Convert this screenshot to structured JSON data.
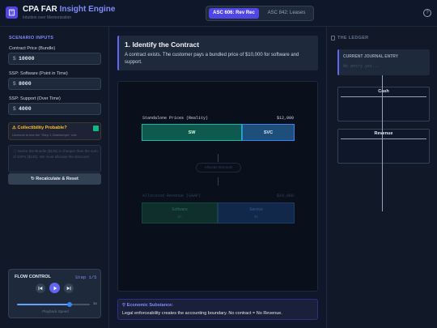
{
  "header": {
    "title_main": "CPA FAR",
    "title_accent": "Insight Engine",
    "subtitle": "Intuition over Memorization",
    "tabs": [
      {
        "label": "ASC 606: Rev Rec",
        "active": true
      },
      {
        "label": "ASC 842: Leases",
        "active": false
      }
    ],
    "help_icon": "?"
  },
  "sidebar": {
    "section_title": "SCENARIO INPUTS",
    "fields": [
      {
        "label": "Contract Price (Bundle)",
        "currency": "$",
        "value": "10000"
      },
      {
        "label": "SSP: Software (Point in Time)",
        "currency": "$",
        "value": "8000"
      },
      {
        "label": "SSP: Support (Over Time)",
        "currency": "$",
        "value": "4000"
      }
    ],
    "collectibility": {
      "label": "Collectibility Probable?",
      "sublabel": "Uncheck to test the \"Step 1 Gatekeeper\" rule.",
      "checked": true
    },
    "notice": "Notice the Bundle ($10k) is cheaper than the sum of SSPs ($12k). We must allocate the discount!",
    "reset_label": "Recalculate & Reset",
    "flow_control": {
      "title": "FLOW CONTROL",
      "step": "Step 1/5",
      "speed_value": "1x",
      "speed_label": "Playback Speed",
      "speed_level": 0.72
    }
  },
  "main": {
    "step_title": "1. Identify the Contract",
    "step_desc": "A contract exists. The customer pays a bundled price of $10,000 for software and support.",
    "viz": {
      "standalone_label": "Standalone Prices (Reality)",
      "standalone_total": "$12,000",
      "sw_label": "SW",
      "svc_label": "SVC",
      "allocate_label": "Allocate Discount",
      "allocated_label": "Allocated Revenue (GAAP)",
      "allocated_total": "$10,000",
      "alloc_sw_label": "Software",
      "alloc_sw_value": "$0",
      "alloc_svc_label": "Service",
      "alloc_svc_value": "$0"
    },
    "econ": {
      "title": "Economic Substance:",
      "desc": "Legal enforceability creates the accounting boundary. No contract = No Revenue."
    }
  },
  "ledger": {
    "title": "THE LEDGER",
    "journal_title": "CURRENT JOURNAL ENTRY",
    "journal_empty": "No entry yet...",
    "accounts": [
      {
        "name": "Cash"
      },
      {
        "name": "Revenue"
      }
    ]
  },
  "colors": {
    "accent": "#6366f1",
    "software": "#14b8a6",
    "service": "#3b82f6",
    "warning": "#fbbf24",
    "check": "#10b981"
  }
}
